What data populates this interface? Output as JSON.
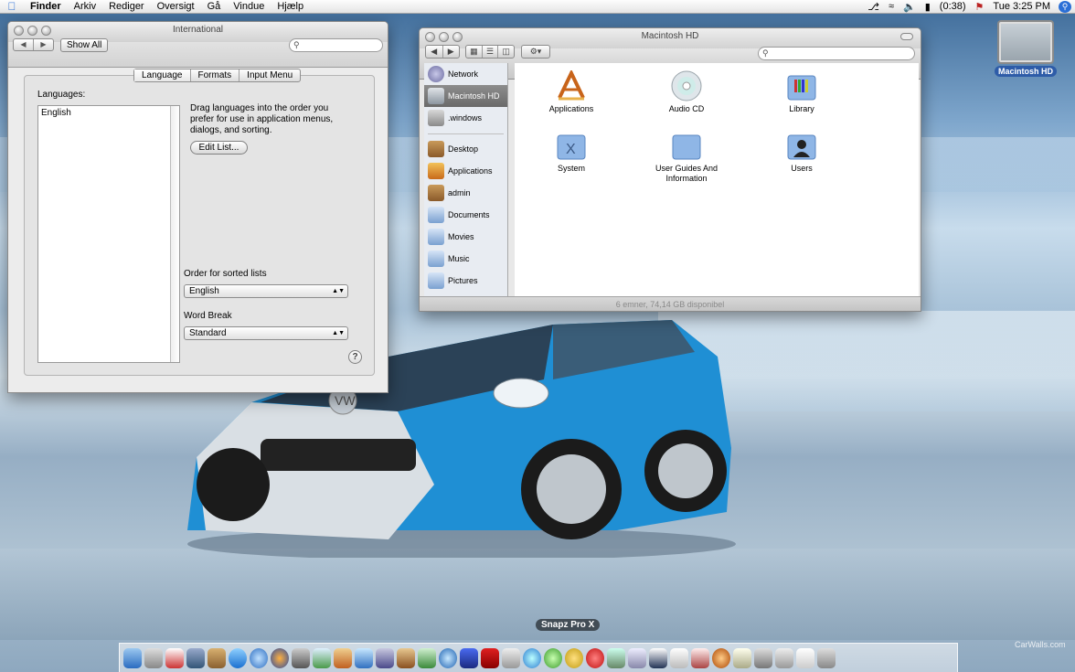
{
  "menubar": {
    "app_name": "Finder",
    "items": [
      "Arkiv",
      "Rediger",
      "Oversigt",
      "Gå",
      "Vindue",
      "Hjælp"
    ],
    "battery": "(0:38)",
    "clock": "Tue 3:25 PM"
  },
  "international_window": {
    "title": "International",
    "show_all_label": "Show All",
    "tabs": [
      "Language",
      "Formats",
      "Input Menu"
    ],
    "languages_label": "Languages:",
    "languages": [
      "English"
    ],
    "drag_text": "Drag languages into the order you prefer for use in application menus, dialogs, and sorting.",
    "edit_list_label": "Edit List...",
    "sort_order_label": "Order for sorted lists",
    "sort_order_value": "English",
    "word_break_label": "Word Break",
    "word_break_value": "Standard",
    "help_label": "?"
  },
  "finder_window": {
    "title": "Macintosh HD",
    "sidebar": [
      {
        "label": "Network",
        "icon": "network-icon"
      },
      {
        "label": "Macintosh HD",
        "icon": "hard-drive-icon",
        "selected": true
      },
      {
        "label": ".windows",
        "icon": "drive-icon"
      },
      {
        "label": "Desktop",
        "icon": "home-icon"
      },
      {
        "label": "Applications",
        "icon": "applications-icon"
      },
      {
        "label": "admin",
        "icon": "home-icon"
      },
      {
        "label": "Documents",
        "icon": "documents-folder-icon"
      },
      {
        "label": "Movies",
        "icon": "movies-folder-icon"
      },
      {
        "label": "Music",
        "icon": "music-folder-icon"
      },
      {
        "label": "Pictures",
        "icon": "pictures-folder-icon"
      }
    ],
    "items": [
      {
        "label": "Applications",
        "icon": "applications-icon"
      },
      {
        "label": "Audio CD",
        "icon": "cd-icon"
      },
      {
        "label": "Library",
        "icon": "library-folder-icon"
      },
      {
        "label": "System",
        "icon": "system-folder-icon"
      },
      {
        "label": "User Guides And Information",
        "icon": "folder-icon"
      },
      {
        "label": "Users",
        "icon": "users-folder-icon"
      }
    ],
    "status": "6 emner, 74,14 GB disponibel"
  },
  "desktop_icon": {
    "label": "Macintosh HD"
  },
  "dock": {
    "hover_label": "Snapz Pro X"
  },
  "watermark": "CarWalls.com"
}
